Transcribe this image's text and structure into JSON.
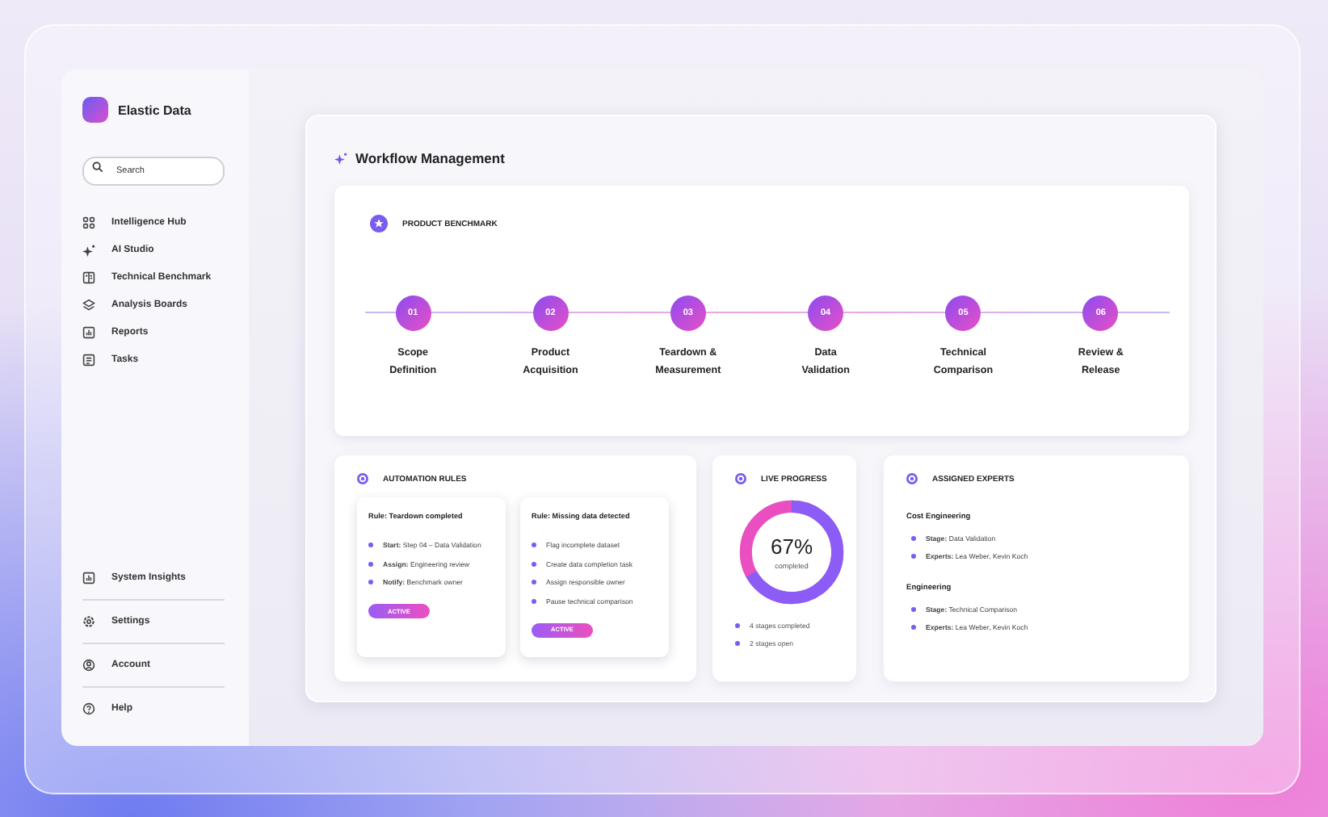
{
  "sidebar": {
    "brand": "Elastic Data",
    "search": {
      "placeholder": "Search"
    },
    "items": [
      {
        "label": "Intelligence Hub"
      },
      {
        "label": "AI Studio"
      },
      {
        "label": "Technical Benchmark"
      },
      {
        "label": "Analysis Boards"
      },
      {
        "label": "Reports"
      },
      {
        "label": "Tasks"
      }
    ],
    "bottom_items": [
      {
        "label": "System Insights"
      },
      {
        "label": "Settings"
      },
      {
        "label": "Account"
      },
      {
        "label": "Help"
      }
    ]
  },
  "main": {
    "title": "Workflow Management",
    "benchmark": {
      "title": "PRODUCT BENCHMARK",
      "steps": [
        {
          "number": "01",
          "label": "Scope Definition"
        },
        {
          "number": "02",
          "label": "Product Acquisition"
        },
        {
          "number": "03",
          "label": "Teardown & Measurement"
        },
        {
          "number": "04",
          "label": "Data Validation"
        },
        {
          "number": "05",
          "label": "Technical Comparison"
        },
        {
          "number": "06",
          "label": "Review & Release"
        }
      ]
    },
    "automation": {
      "title": "AUTOMATION RULES",
      "rules": [
        {
          "title": "Rule: Teardown completed",
          "items": [
            "**Start:** Step 04 – Data Validation",
            "**Assign:** Engineering review",
            "**Notify:** Benchmark owner"
          ],
          "status": "ACTIVE"
        },
        {
          "title": "Rule: Missing data detected",
          "items": [
            "Flag incomplete dataset",
            "Create data completion task",
            "Assign responsible owner",
            "Pause technical comparison"
          ],
          "status": "ACTIVE"
        }
      ]
    },
    "progress": {
      "title": "LIVE PROGRESS",
      "percent": "67%",
      "caption": "completed",
      "level": 0.67,
      "stats": [
        "4 stages completed",
        "2 stages open"
      ]
    },
    "experts": {
      "title": "ASSIGNED EXPERTS",
      "groups": [
        {
          "name": "Cost Engineering",
          "items": [
            "**Stage:** Data Validation",
            "**Experts:** Lea Weber, Kevin Koch"
          ]
        },
        {
          "name": "Engineering",
          "items": [
            "**Stage:** Technical Comparison",
            "**Experts:** Lea Weber, Kevin Koch"
          ]
        }
      ]
    }
  }
}
